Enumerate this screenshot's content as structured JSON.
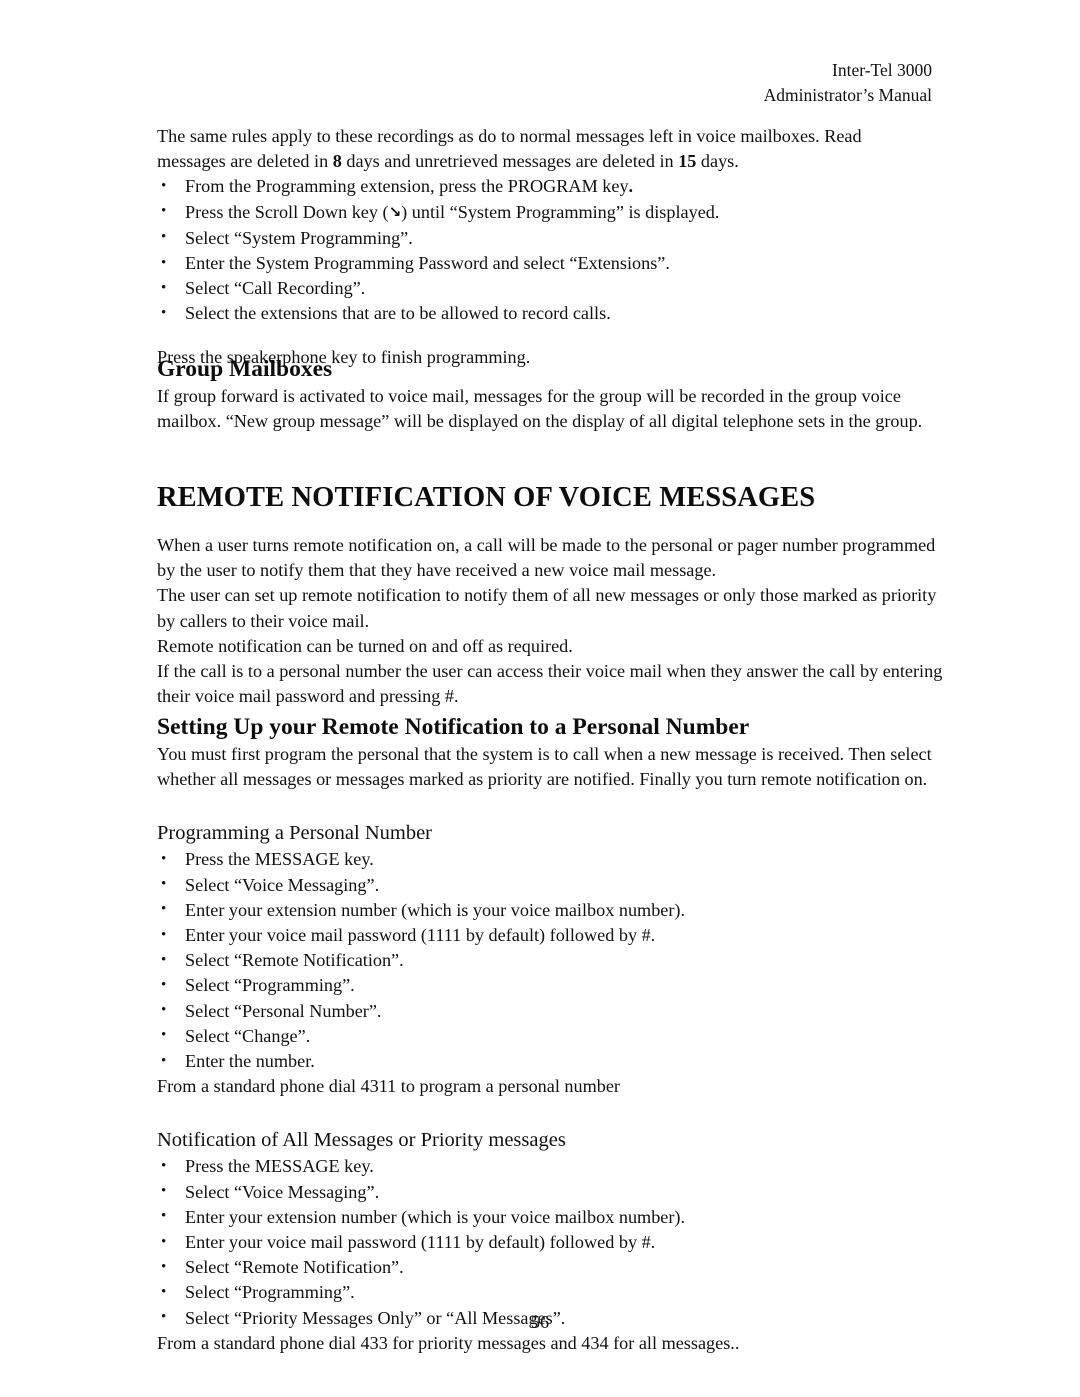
{
  "header": {
    "line1": "Inter-Tel 3000",
    "line2": "Administrator’s Manual"
  },
  "intro": {
    "paragraph": "The same rules apply to these recordings as do to normal messages left in voice mailboxes. Read messages are deleted in 8 days and unretrieved messages are deleted in 15 days.",
    "paragraph_part1": "The same rules apply to these recordings as do to normal messages left in voice mailboxes. Read messages are deleted in ",
    "bold_days_read": "8",
    "paragraph_part2": " days and unretrieved messages are deleted in ",
    "bold_days_unretrieved": "15",
    "paragraph_part3": " days.",
    "bullets": [
      "From the Programming extension, press the PROGRAM key.",
      "Press the Scroll Down key (↘) until “System Programming” is displayed.",
      "Select “System Programming”.",
      "Enter the System Programming Password and select “Extensions”.",
      "Select “Call Recording”.",
      "Select the extensions that are to be allowed to record calls."
    ],
    "bullet1_prefix": "From the Programming extension, press the PROGRAM key",
    "bullet1_bold_period": ".",
    "bullet2_prefix": "Press the Scroll Down key (",
    "bullet2_arrow": "↘",
    "bullet2_suffix": ") until “System Programming” is displayed.",
    "closing": "Press the speakerphone key to finish programming."
  },
  "group_mailboxes": {
    "heading": "Group Mailboxes",
    "paragraph": "If group forward is activated to voice mail, messages for the group will be recorded in the group voice mailbox. “New group message” will be displayed on the display of all digital telephone sets in the group."
  },
  "remote_notification": {
    "heading": "REMOTE NOTIFICATION OF VOICE MESSAGES",
    "paragraphs": [
      "When a user turns remote notification on, a call will be made to the personal or pager number programmed by the user to notify them that they have received a new voice mail message.",
      "The user can set up remote notification to notify them of all new messages or only those marked as priority by callers to their voice mail.",
      "Remote notification can be turned on and off as required.",
      "If the call is to a personal number the user can access their voice mail when they answer the call by entering their voice mail password and pressing #."
    ]
  },
  "setting_up": {
    "heading": "Setting Up your Remote Notification to a Personal Number",
    "paragraph": "You must first program the personal that the system is to call when a new message is received. Then select whether all messages or messages marked as priority are notified. Finally you turn remote notification on."
  },
  "programming_personal_number": {
    "heading": "Programming a Personal Number",
    "bullets": [
      "Press the MESSAGE key.",
      "Select “Voice Messaging”.",
      "Enter your extension number (which is your voice mailbox number).",
      "Enter your voice mail password (1111 by default) followed by #.",
      "Select “Remote Notification”.",
      "Select “Programming”.",
      "Select  “Personal Number”.",
      "Select “Change”.",
      "Enter the number."
    ],
    "footer": "From a standard phone dial 4311 to program a personal number"
  },
  "notification_all_or_priority": {
    "heading": "Notification of All Messages or Priority messages",
    "bullets": [
      "Press the MESSAGE key.",
      "Select “Voice Messaging”.",
      "Enter your extension number (which is your voice mailbox number).",
      "Enter your voice mail password (1111 by default) followed by #.",
      "Select “Remote Notification”.",
      "Select “Programming”.",
      "Select  “Priority Messages Only” or “All Messages”."
    ],
    "footer": "From a standard phone dial 433 for priority messages and 434 for all messages.."
  },
  "footer": {
    "page_number": "56"
  }
}
